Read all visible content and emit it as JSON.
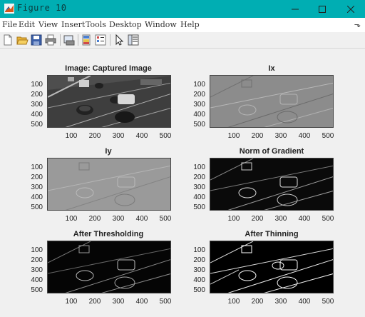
{
  "window": {
    "title": "Figure 10"
  },
  "menu": [
    "File",
    "Edit",
    "View",
    "Insert",
    "Tools",
    "Desktop",
    "Window",
    "Help"
  ],
  "toolbar_icons": [
    "new-figure-icon",
    "open-file-icon",
    "save-icon",
    "print-icon",
    "print-preview-icon",
    "link-plot-icon",
    "insert-legend-icon",
    "pointer-icon",
    "property-inspector-icon"
  ],
  "plots": [
    {
      "title": "Image: Captured Image",
      "style": "photo"
    },
    {
      "title": "Ix",
      "style": "emboss"
    },
    {
      "title": "Iy",
      "style": "emboss-light"
    },
    {
      "title": "Norm of Gradient",
      "style": "edges-dark"
    },
    {
      "title": "After Thresholding",
      "style": "edges-dark"
    },
    {
      "title": "After Thinning",
      "style": "edges-bright"
    }
  ],
  "y_ticks": [
    "100",
    "200",
    "300",
    "400",
    "500"
  ],
  "x_ticks": [
    "100",
    "200",
    "300",
    "400",
    "500"
  ]
}
